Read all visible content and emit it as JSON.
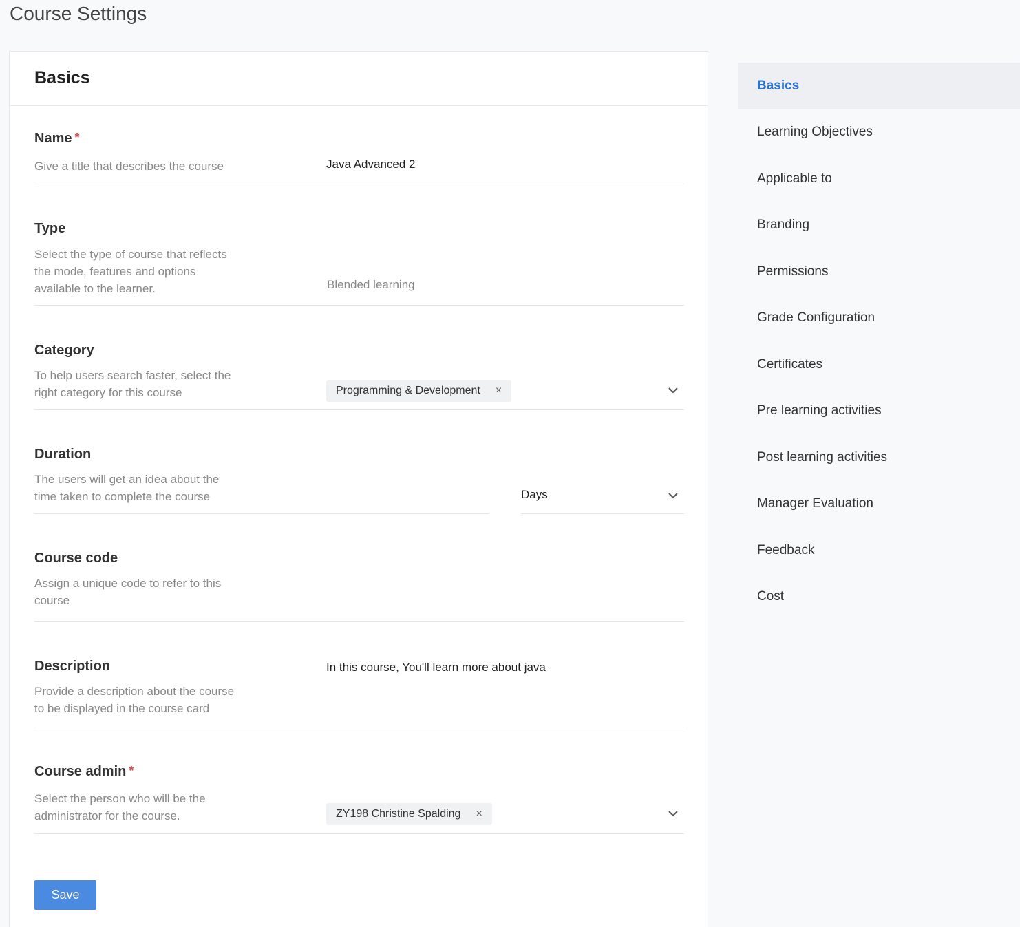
{
  "page": {
    "title": "Course Settings"
  },
  "section": {
    "title": "Basics"
  },
  "fields": {
    "name": {
      "label": "Name",
      "required_mark": "*",
      "hint": "Give a title that describes the course",
      "value": "Java Advanced 2"
    },
    "type": {
      "label": "Type",
      "hint": "Select the type of course that reflects the mode, features and options available to the learner.",
      "value": "Blended learning"
    },
    "category": {
      "label": "Category",
      "hint": "To help users search faster, select the right category for this course",
      "chip": "Programming & Development",
      "chip_remove": "×"
    },
    "duration": {
      "label": "Duration",
      "hint": "The users will get an idea about the time taken to complete the course",
      "unit": "Days"
    },
    "course_code": {
      "label": "Course code",
      "hint": "Assign a unique code to refer to this course"
    },
    "description": {
      "label": "Description",
      "hint": "Provide a description about the course to be displayed in the course card",
      "value": "In this course, You'll learn more about java"
    },
    "course_admin": {
      "label": "Course admin",
      "required_mark": "*",
      "hint": "Select the person who will be the administrator for the course.",
      "chip": "ZY198 Christine Spalding",
      "chip_remove": "×"
    }
  },
  "actions": {
    "save_label": "Save"
  },
  "sidebar": {
    "items": [
      {
        "label": "Basics",
        "active": true
      },
      {
        "label": "Learning Objectives"
      },
      {
        "label": "Applicable to"
      },
      {
        "label": "Branding"
      },
      {
        "label": "Permissions"
      },
      {
        "label": "Grade Configuration"
      },
      {
        "label": "Certificates"
      },
      {
        "label": "Pre learning activities"
      },
      {
        "label": "Post learning activities"
      },
      {
        "label": "Manager Evaluation"
      },
      {
        "label": "Feedback"
      },
      {
        "label": "Cost"
      }
    ]
  },
  "colors": {
    "accent": "#2a73d2",
    "button": "#4a8ae0",
    "required": "#e04848"
  }
}
